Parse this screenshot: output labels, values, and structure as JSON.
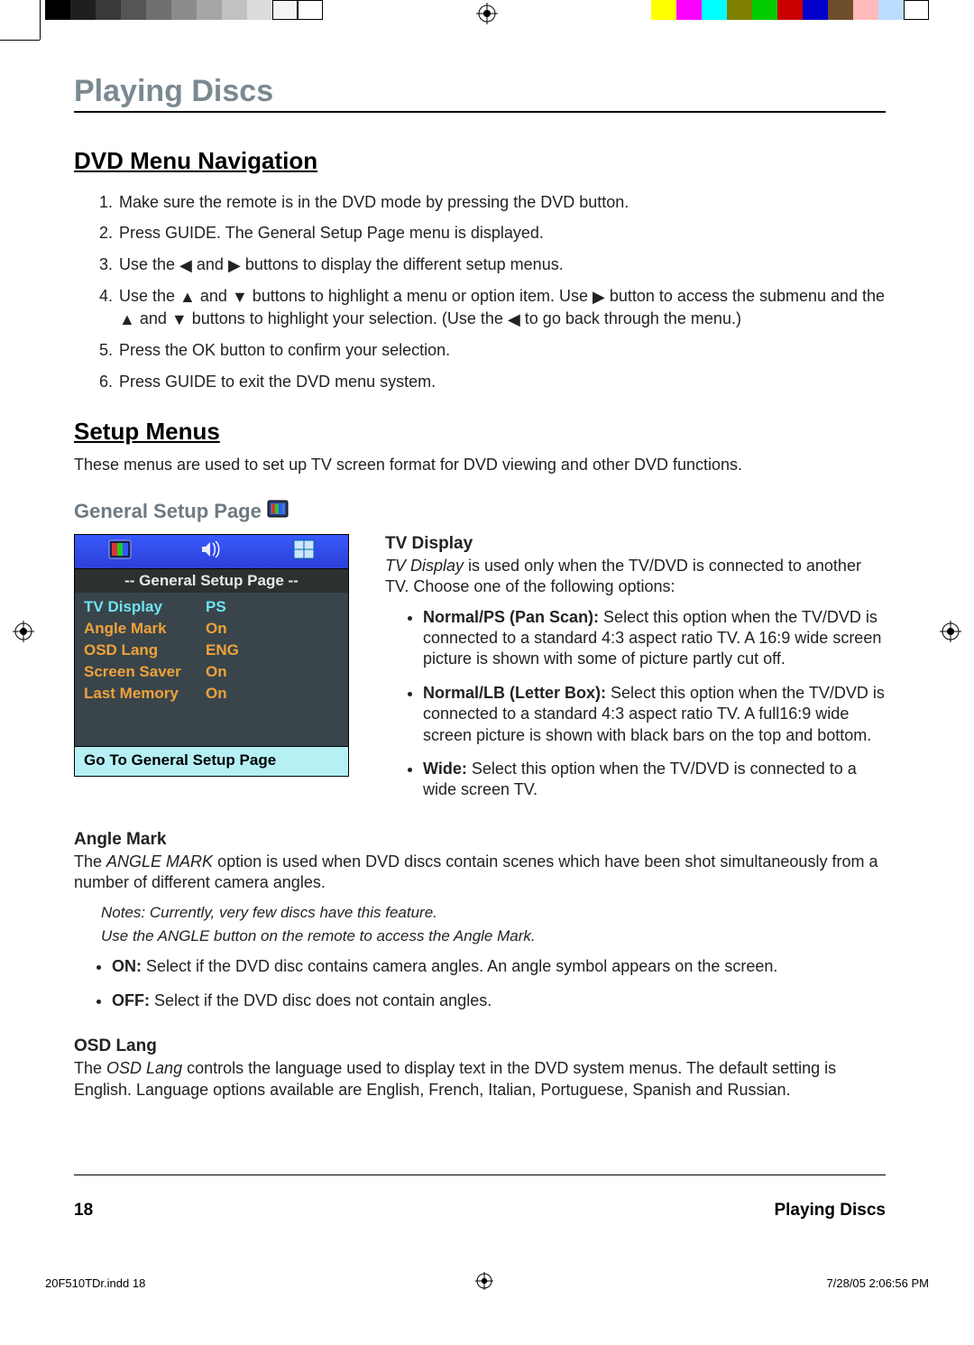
{
  "section_title": "Playing Discs",
  "h_dvd_nav": "DVD Menu Navigation",
  "nav_items": {
    "i1": "Make sure the remote is in the DVD mode by pressing the DVD button.",
    "i2": "Press GUIDE. The General Setup Page menu is displayed.",
    "i3_pre": "Use the ",
    "i3_mid": " and ",
    "i3_post": " buttons to display the different setup menus.",
    "i4_a": "Use the ",
    "i4_b": " and ",
    "i4_c": " buttons to highlight a menu or option item. Use ",
    "i4_d": " button to access the submenu and the ",
    "i4_e": " and ",
    "i4_f": " buttons to highlight your selection. (Use the ",
    "i4_g": " to go back through the menu.)",
    "i5": "Press the  OK button to confirm your selection.",
    "i6": "Press GUIDE to exit the DVD menu system."
  },
  "h_setup": "Setup Menus",
  "setup_p": "These menus are used to set up TV screen format for DVD viewing and other DVD functions.",
  "h_gsp": "General Setup Page",
  "osd": {
    "title": "--  General Setup Page  --",
    "rows": [
      {
        "k": "TV Display",
        "v": "PS",
        "sel": true
      },
      {
        "k": "Angle Mark",
        "v": "On",
        "sel": false
      },
      {
        "k": "OSD Lang",
        "v": "ENG",
        "sel": false
      },
      {
        "k": "Screen Saver",
        "v": "On",
        "sel": false
      },
      {
        "k": "Last Memory",
        "v": "On",
        "sel": false
      }
    ],
    "footer": "Go To General Setup Page"
  },
  "tv": {
    "h": "TV Display",
    "p_pre": "TV Display",
    "p_post": " is used only when the TV/DVD is connected to another TV.  Choose one of the following options:",
    "b1_h": "Normal/PS (Pan Scan):",
    "b1_t": "  Select this option when the TV/DVD is connected to a standard 4:3 aspect ratio TV. A 16:9 wide screen picture is shown with some of picture partly cut off.",
    "b2_h": "Normal/LB (Letter Box):",
    "b2_t": "  Select this option when the TV/DVD is connected to a standard 4:3 aspect ratio TV.  A full16:9 wide screen picture is shown with black bars on the top and bottom.",
    "b3_h": "Wide:",
    "b3_t": " Select this option when the TV/DVD is connected to a wide screen TV."
  },
  "angle": {
    "h": "Angle Mark",
    "p_pre": "The ",
    "p_em": "ANGLE MARK",
    "p_post": " option is used when DVD discs contain scenes which have been shot simultaneously from a number of different camera angles.",
    "note1": "Notes: Currently, very few discs have this feature.",
    "note2": "Use the ANGLE button on the remote to access the Angle Mark.",
    "b_on_h": "ON:",
    "b_on_t": " Select if the DVD disc contains camera angles. An angle symbol appears on the screen.",
    "b_off_h": "OFF:",
    "b_off_t": " Select if the DVD disc does not contain angles."
  },
  "osd_lang": {
    "h": "OSD Lang",
    "p_pre": "The ",
    "p_em": "OSD Lang",
    "p_post": " controls the language used to display text in the DVD system menus. The default setting is English. Language options available are English, French, Italian, Portuguese, Spanish and Russian."
  },
  "footer": {
    "page": "18",
    "section": "Playing Discs"
  },
  "imposition": {
    "file": "20F510TDr.indd   18",
    "ts": "7/28/05   2:06:56 PM"
  }
}
